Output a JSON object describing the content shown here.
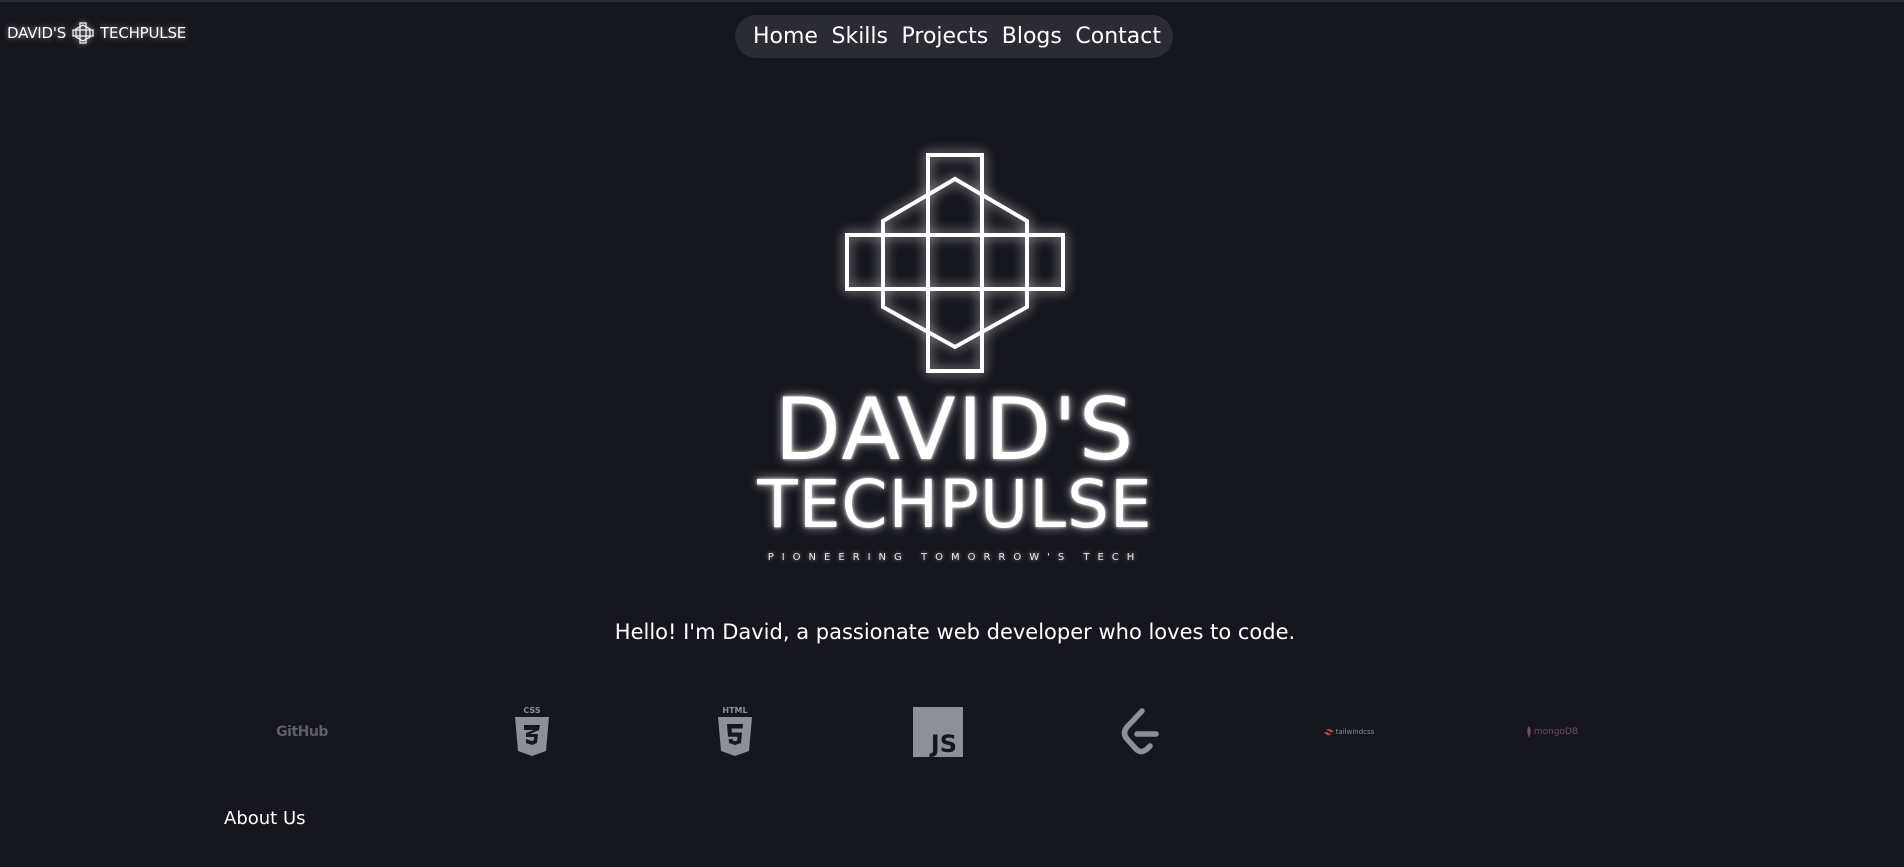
{
  "brand": {
    "prefix": "DAVID'S",
    "suffix": "TECHPULSE",
    "logo_icon": "cross-outline-icon"
  },
  "nav": {
    "items": [
      {
        "label": "Home"
      },
      {
        "label": "Skills"
      },
      {
        "label": "Projects"
      },
      {
        "label": "Blogs"
      },
      {
        "label": "Contact"
      }
    ]
  },
  "hero": {
    "logo_icon": "cross-outline-icon",
    "title_line1": "DAVID'S",
    "title_line2": "TECHPULSE",
    "tagline": "PIONEERING TOMORROW'S TECH"
  },
  "intro": {
    "text": "Hello! I'm David, a passionate web developer who loves to code."
  },
  "tech_stack": [
    {
      "name": "GitHub",
      "icon": "github-icon",
      "label": "GitHub"
    },
    {
      "name": "CSS3",
      "icon": "css3-icon",
      "label": "CSS"
    },
    {
      "name": "HTML5",
      "icon": "html5-icon",
      "label": "HTML"
    },
    {
      "name": "JavaScript",
      "icon": "javascript-icon",
      "label": "JS"
    },
    {
      "name": "LeetCode",
      "icon": "leetcode-icon"
    },
    {
      "name": "Tailwind CSS",
      "icon": "tailwindcss-icon",
      "label": "tailwindcss"
    },
    {
      "name": "MongoDB",
      "icon": "mongodb-icon",
      "label": "mongoDB"
    }
  ],
  "about": {
    "heading": "About Us"
  },
  "colors": {
    "background": "#16171e",
    "nav_background": "#2b2c33",
    "text": "#ffffff",
    "icon_gray": "#8e9096"
  }
}
